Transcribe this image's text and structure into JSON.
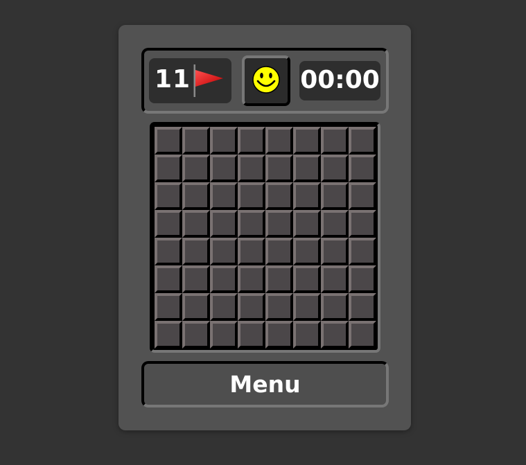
{
  "game": {
    "flags_remaining": "11",
    "timer": "00:00",
    "face_state": "smiley-face-icon",
    "rows": 8,
    "cols": 8
  },
  "menu_label": "Menu",
  "colors": {
    "background": "#333333",
    "panel": "#525252",
    "display": "#2e2e2e",
    "cell": "#4b4749",
    "flag": "#ff0000",
    "face": "#ffff00"
  }
}
